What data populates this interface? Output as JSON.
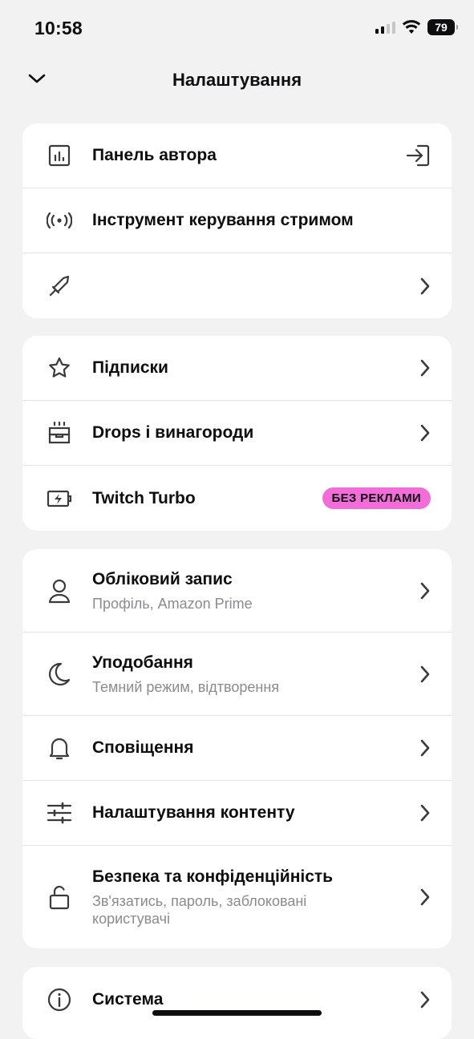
{
  "status": {
    "time": "10:58",
    "battery": "79"
  },
  "header": {
    "title": "Налаштування"
  },
  "group1": {
    "creator_dashboard": "Панель автора",
    "stream_manager": "Інструмент керування стримом",
    "third": ""
  },
  "group2": {
    "subscriptions": "Підписки",
    "drops": "Drops і винагороди",
    "turbo": "Twitch Turbo",
    "turbo_badge": "БЕЗ РЕКЛАМИ"
  },
  "group3": {
    "account": {
      "label": "Обліковий запис",
      "sub": "Профіль, Amazon Prime"
    },
    "preferences": {
      "label": "Уподобання",
      "sub": "Темний режим, відтворення"
    },
    "notifications": {
      "label": "Сповіщення"
    },
    "content_settings": {
      "label": "Налаштування контенту"
    },
    "security": {
      "label": "Безпека та конфіденційність",
      "sub": "Зв'язатись, пароль, заблоковані користувачі"
    }
  },
  "group4": {
    "system": "Система"
  },
  "colors": {
    "accent_badge": "#f26dd9",
    "background": "#f2f2f3"
  },
  "icons": [
    "chevron-down-icon",
    "bar-chart-icon",
    "login-icon",
    "broadcast-icon",
    "sword-icon",
    "chevron-right-icon",
    "star-icon",
    "gift-box-icon",
    "battery-bolt-icon",
    "person-icon",
    "moon-icon",
    "bell-icon",
    "sliders-icon",
    "unlock-icon",
    "info-icon"
  ]
}
